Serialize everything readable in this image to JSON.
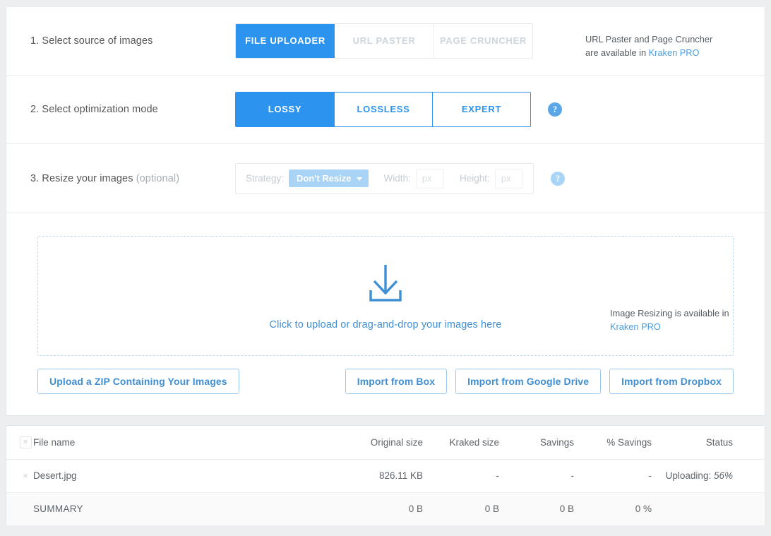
{
  "steps": {
    "source": {
      "label": "1. Select source of images",
      "tabs": [
        {
          "label": "FILE UPLOADER",
          "active": true
        },
        {
          "label": "URL PASTER",
          "active": false
        },
        {
          "label": "PAGE CRUNCHER",
          "active": false
        }
      ],
      "note_line1": "URL Paster and Page Cruncher",
      "note_line2_prefix": "are available in ",
      "note_link": "Kraken PRO"
    },
    "mode": {
      "label": "2. Select optimization mode",
      "tabs": [
        {
          "label": "LOSSY",
          "active": true
        },
        {
          "label": "LOSSLESS",
          "active": false
        },
        {
          "label": "EXPERT",
          "active": false
        }
      ],
      "help": "?"
    },
    "resize": {
      "label_main": "3. Resize your images ",
      "label_optional": "(optional)",
      "strategy_label": "Strategy:",
      "strategy_value": "Don't Resize",
      "width_label": "Width:",
      "width_placeholder": "px",
      "width_value": "",
      "height_label": "Height:",
      "height_placeholder": "px",
      "height_value": "",
      "help": "?",
      "note_line1": "Image Resizing is available in",
      "note_link": "Kraken PRO"
    }
  },
  "dropzone": {
    "icon": "download-arrow-icon",
    "text": "Click to upload or drag-and-drop your images here"
  },
  "actions": {
    "zip": "Upload a ZIP Containing Your Images",
    "box": "Import from Box",
    "gdrive": "Import from Google Drive",
    "dropbox": "Import from Dropbox"
  },
  "table": {
    "headers": {
      "delete": "×",
      "file_name": "File name",
      "original_size": "Original size",
      "kraked_size": "Kraked size",
      "savings": "Savings",
      "percent_savings": "% Savings",
      "status": "Status"
    },
    "rows": [
      {
        "delete": "×",
        "file_name": "Desert.jpg",
        "original_size": "826.11 KB",
        "kraked_size": "-",
        "savings": "-",
        "percent_savings": "-",
        "status_label": "Uploading: ",
        "status_value": "56%"
      }
    ],
    "summary": {
      "label": "SUMMARY",
      "original_size": "0 B",
      "kraked_size": "0 B",
      "savings": "0 B",
      "percent_savings": "0 %"
    }
  },
  "colors": {
    "accent": "#2c94ee",
    "accent_light": "#a9d4f5",
    "link": "#4a9de0",
    "page_bg": "#eceef0"
  }
}
